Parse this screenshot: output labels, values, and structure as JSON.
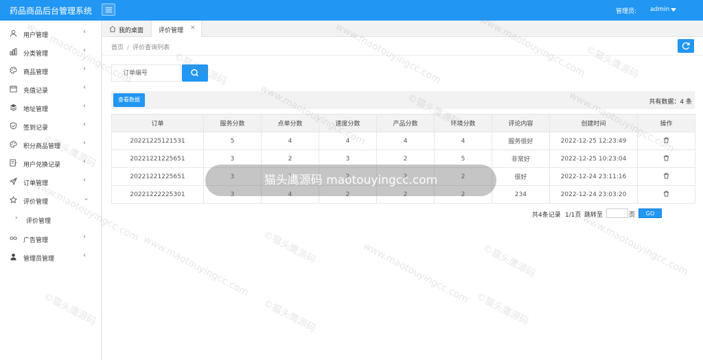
{
  "app": {
    "title": "药品商品后台管理系统"
  },
  "header": {
    "admin_label": "管理员:",
    "admin_name": "admin"
  },
  "sidebar": {
    "items": [
      {
        "label": "用户管理",
        "icon": "user-icon"
      },
      {
        "label": "分类管理",
        "icon": "bar-chart-icon"
      },
      {
        "label": "商品管理",
        "icon": "palette-icon"
      },
      {
        "label": "充值记录",
        "icon": "calendar-icon"
      },
      {
        "label": "地址管理",
        "icon": "layers-icon"
      },
      {
        "label": "签到记录",
        "icon": "shield-check-icon"
      },
      {
        "label": "积分商品管理",
        "icon": "palette-icon"
      },
      {
        "label": "用户兑换记录",
        "icon": "edit-document-icon"
      },
      {
        "label": "订单管理",
        "icon": "send-icon"
      },
      {
        "label": "评价管理",
        "icon": "star-icon"
      },
      {
        "label": "评价管理",
        "icon": "sub-item"
      },
      {
        "label": "广告管理",
        "icon": "infinity-icon"
      },
      {
        "label": "管理员管理",
        "icon": "admin-user-icon"
      }
    ]
  },
  "tabs": {
    "home": "我的桌面",
    "active": "评价管理"
  },
  "breadcrumb": {
    "home": "首页",
    "sep": "/",
    "current": "评价查询列表"
  },
  "search": {
    "placeholder": "订单编号"
  },
  "toolbar": {
    "view_button": "查看数据",
    "total_label": "共有数据：4 条"
  },
  "table": {
    "headers": [
      "订单",
      "服务分数",
      "点单分数",
      "速度分数",
      "产品分数",
      "环境分数",
      "评论内容",
      "创建时间",
      "操作"
    ],
    "rows": [
      [
        "20221225121531",
        "5",
        "4",
        "4",
        "4",
        "4",
        "服务很好",
        "2022-12-25 12:23:49"
      ],
      [
        "20221221225651",
        "3",
        "2",
        "3",
        "2",
        "5",
        "非常好",
        "2022-12-25 10:23:04"
      ],
      [
        "20221221225651",
        "3",
        "3",
        "2",
        "2",
        "2",
        "很好",
        "2022-12-24 23:11:16"
      ],
      [
        "20221222225301",
        "3",
        "4",
        "2",
        "2",
        "2",
        "234",
        "2022-12-24 23:03:20"
      ]
    ]
  },
  "pager": {
    "summary": "共4条记录",
    "pages": "1/1页",
    "goto_label": "跳转至",
    "page_suffix": "页",
    "go_button": "GO"
  },
  "watermark": {
    "text": "©猫头鹰源码",
    "url": "www.maotouyingcc.com",
    "banner": "猫头鹰源码 maotouyingcc.com"
  },
  "colors": {
    "primary": "#2196f3",
    "header_bg": "#2196f3"
  }
}
